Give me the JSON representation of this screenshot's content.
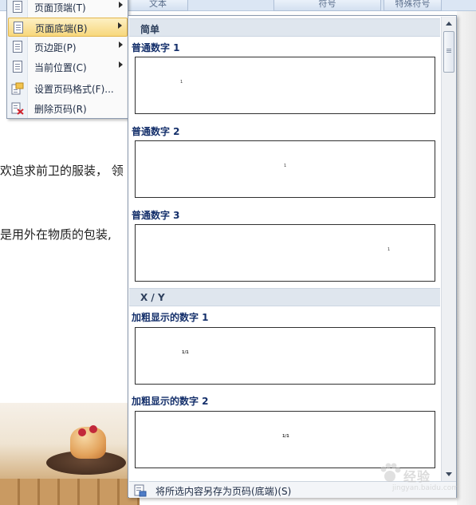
{
  "ribbon": {
    "tabs": [
      "文本",
      "符号",
      "特殊符号"
    ]
  },
  "document": {
    "line1": "欢追求前卫的服装， 领",
    "line2": "是用外在物质的包装,"
  },
  "menu": {
    "items": [
      {
        "label": "页面顶端(T)",
        "has_submenu": true
      },
      {
        "label": "页面底端(B)",
        "has_submenu": true,
        "active": true
      },
      {
        "label": "页边距(P)",
        "has_submenu": true
      },
      {
        "label": "当前位置(C)",
        "has_submenu": true
      },
      {
        "label": "设置页码格式(F)...",
        "has_submenu": false
      },
      {
        "label": "删除页码(R)",
        "has_submenu": false
      }
    ]
  },
  "gallery": {
    "sections": [
      {
        "header": "简单"
      },
      {
        "header": "X / Y"
      }
    ],
    "items": [
      {
        "title": "普通数字 1",
        "preview": "1"
      },
      {
        "title": "普通数字 2",
        "preview": "1"
      },
      {
        "title": "普通数字 3",
        "preview": "1"
      },
      {
        "title": "加粗显示的数字 1",
        "preview": "1/1"
      },
      {
        "title": "加粗显示的数字 2",
        "preview": "1/1"
      }
    ],
    "footer_label": "将所选内容另存为页码(底端)(S)"
  },
  "watermark": {
    "text": "经验",
    "url": "jingyan.baidu.com"
  }
}
